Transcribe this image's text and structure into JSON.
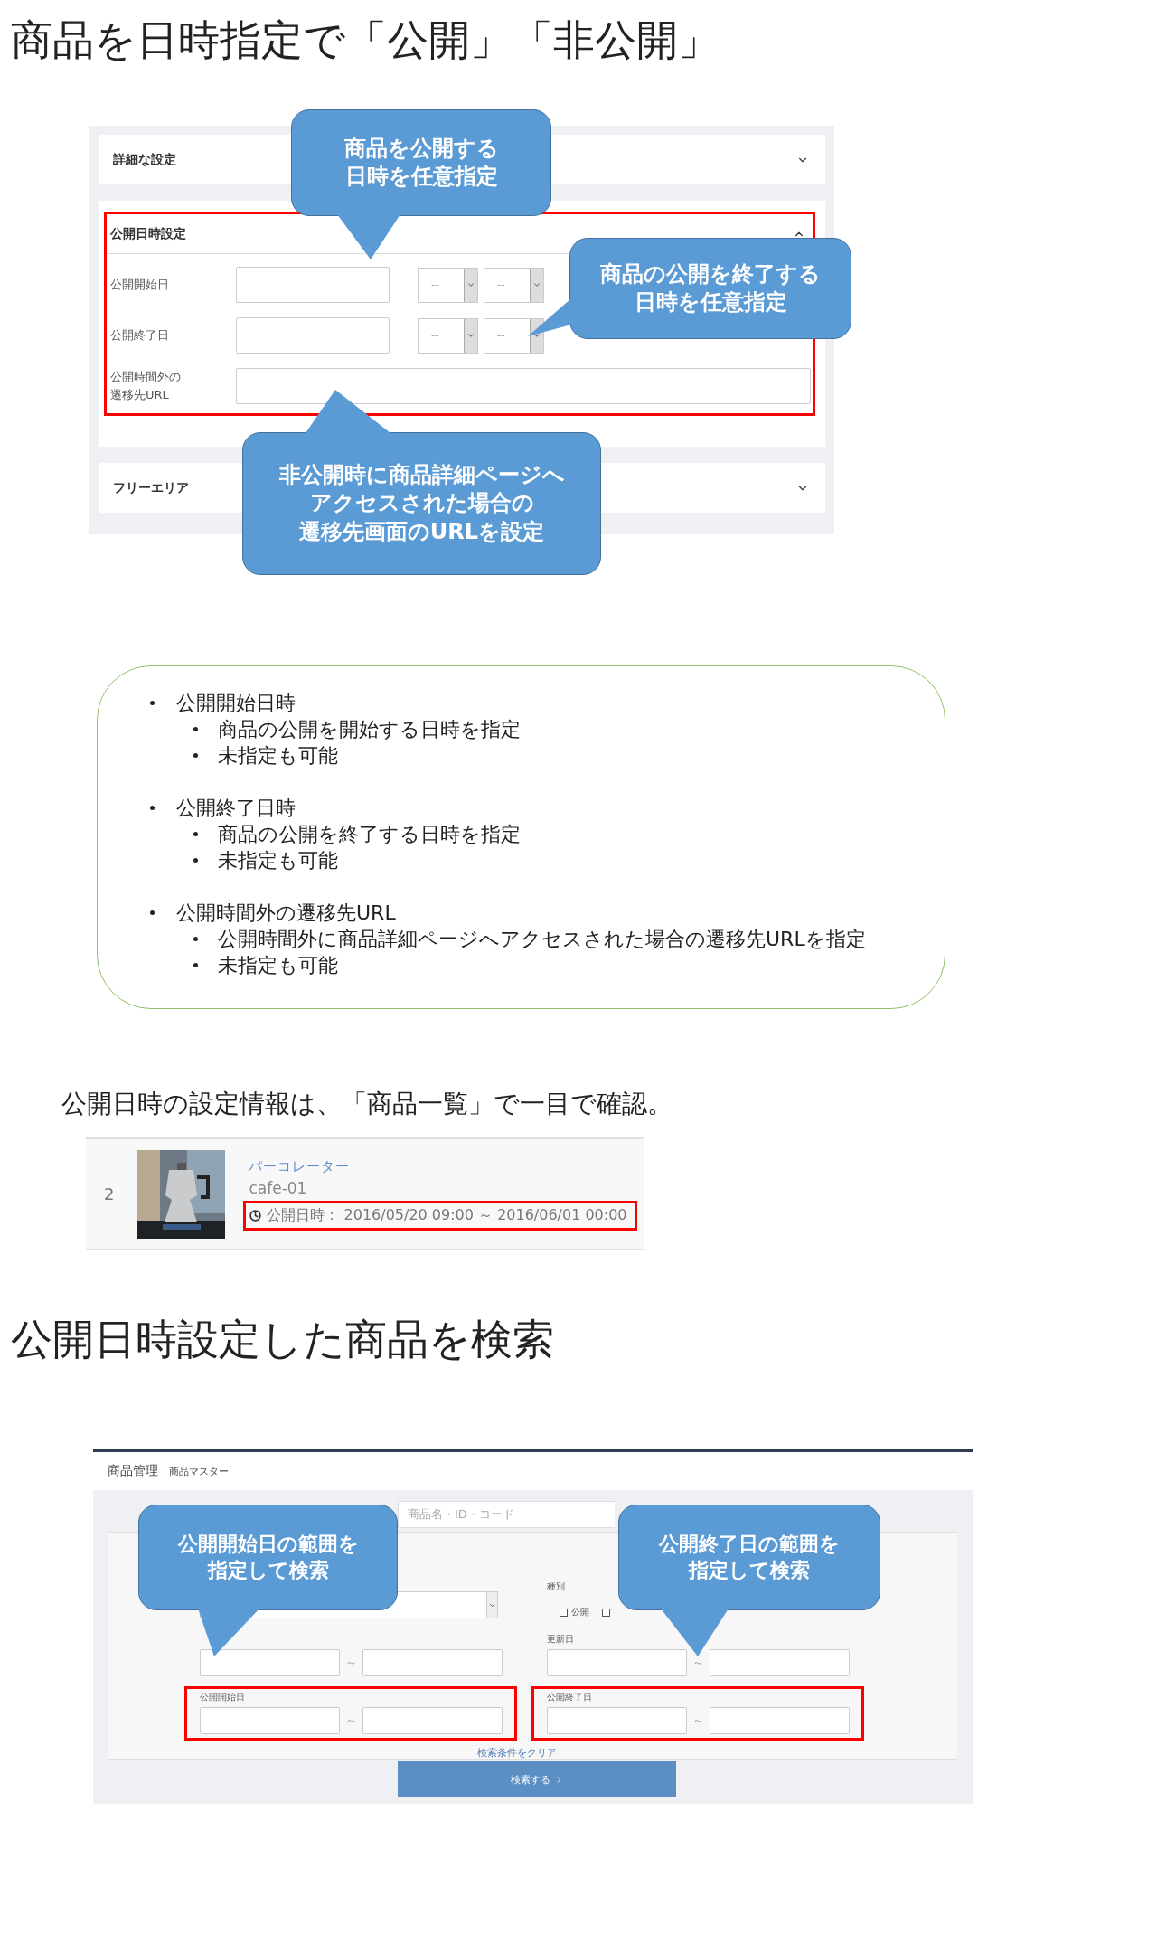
{
  "section1": {
    "title": "商品を日時指定で「公開」「非公開」"
  },
  "settings_screenshot": {
    "panels": [
      {
        "title": "詳細な設定",
        "expanded": false
      },
      {
        "title": "公開日時設定",
        "expanded": true,
        "highlighted": true,
        "fields": [
          {
            "kind": "datetime",
            "label": "公開開始日",
            "hour": "--",
            "minute": "--"
          },
          {
            "kind": "datetime",
            "label": "公開終了日",
            "hour": "--",
            "minute": "--"
          },
          {
            "kind": "url",
            "label": "公開時間外の遷移先URL"
          }
        ]
      },
      {
        "title": "フリーエリア",
        "expanded": false
      }
    ],
    "callouts": [
      {
        "lines": [
          "商品を公開する",
          "日時を任意指定"
        ]
      },
      {
        "lines": [
          "商品の公開を終了する",
          "日時を任意指定"
        ]
      },
      {
        "lines": [
          "非公開時に商品詳細ページへ",
          "アクセスされた場合の",
          "遷移先画面のURLを設定"
        ]
      }
    ]
  },
  "notes": [
    {
      "text": "公開開始日時",
      "children": [
        "商品の公開を開始する日時を指定",
        "未指定も可能"
      ]
    },
    {
      "text": "公開終了日時",
      "children": [
        "商品の公開を終了する日時を指定",
        "未指定も可能"
      ]
    },
    {
      "text": "公開時間外の遷移先URL",
      "children": [
        "公開時間外に商品詳細ページへアクセスされた場合の遷移先URLを指定",
        "未指定も可能"
      ]
    }
  ],
  "summary": "公開日時の設定情報は、「商品一覧」で一目で確認。",
  "product_row": {
    "index": "2",
    "name": "パーコレーター",
    "code": "cafe-01",
    "schedule_label": "公開日時：",
    "schedule": "2016/05/20 09:00 ～ 2016/06/01 00:00"
  },
  "section2": {
    "title": "公開日時設定した商品を検索"
  },
  "search_screenshot": {
    "breadcrumb": [
      "商品管理",
      "商品マスター"
    ],
    "search_placeholder": "商品名・ID・コード",
    "filters": [
      {
        "kind": "select"
      },
      {
        "kind": "checkboxes",
        "label": "種別",
        "options": [
          {
            "label": "公開",
            "checked": false
          },
          {
            "checked": false
          }
        ]
      },
      {
        "kind": "range",
        "separator": "～",
        "highlighted": false
      },
      {
        "kind": "range",
        "label": "更新日",
        "separator": "～",
        "highlighted": false
      },
      {
        "kind": "range",
        "label": "公開開始日",
        "separator": "～",
        "highlighted": true
      },
      {
        "kind": "range",
        "label": "公開終了日",
        "separator": "～",
        "highlighted": true
      }
    ],
    "clear_link": "検索条件をクリア",
    "search_button": "検索する",
    "callouts": [
      {
        "lines": [
          "公開開始日の範囲を",
          "指定して検索"
        ]
      },
      {
        "lines": [
          "公開終了日の範囲を",
          "指定して検索"
        ]
      }
    ]
  }
}
